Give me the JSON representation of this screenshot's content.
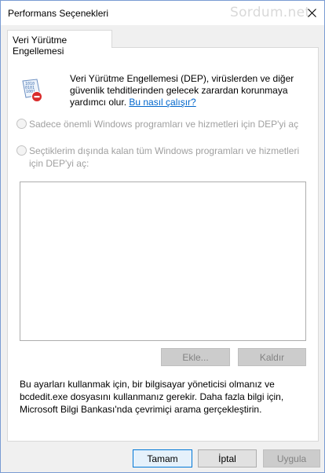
{
  "window": {
    "title": "Performans Seçenekleri",
    "watermark": "Sordum.net"
  },
  "tabs": [
    {
      "label": "Veri Yürütme Engellemesi",
      "active": true
    }
  ],
  "dep": {
    "description": "Veri Yürütme Engellemesi (DEP), virüslerden ve diğer güvenlik tehditlerinden gelecek zarardan korunmaya yardımcı olur. ",
    "link_text": "Bu nasıl çalışır?",
    "icon": "dep-shield-icon"
  },
  "options": [
    {
      "label": "Sadece önemli Windows programları ve hizmetleri için DEP'yi aç",
      "checked": false,
      "enabled": false
    },
    {
      "label": "Seçtiklerim dışında kalan tüm Windows programları ve hizmetleri için DEP'yi aç:",
      "checked": false,
      "enabled": false
    }
  ],
  "list": {
    "items": []
  },
  "list_buttons": {
    "add": "Ekle...",
    "remove": "Kaldır"
  },
  "info_text": "Bu ayarları kullanmak için, bir bilgisayar yöneticisi olmanız ve bcdedit.exe dosyasını kullanmanız gerekir. Daha fazla bilgi için, Microsoft Bilgi Bankası'nda çevrimiçi arama gerçekleştirin.",
  "footer": {
    "ok": "Tamam",
    "cancel": "İptal",
    "apply": "Uygula"
  },
  "colors": {
    "link": "#0066cc",
    "primary_border": "#0078d7",
    "disabled_text": "#a0a0a0"
  }
}
